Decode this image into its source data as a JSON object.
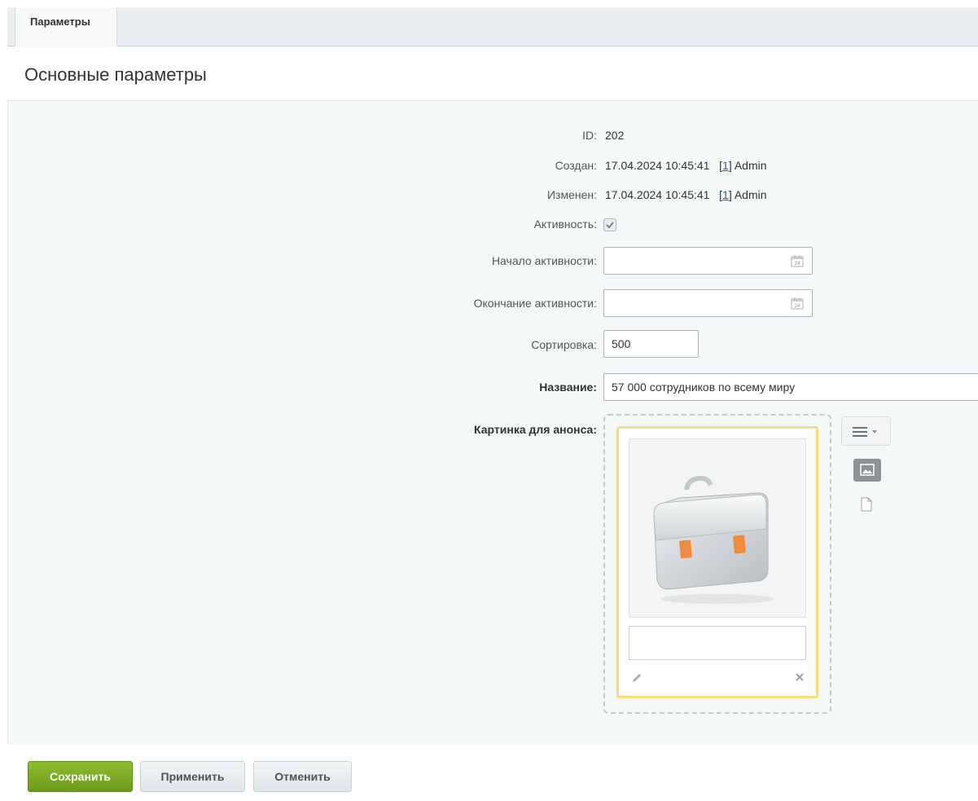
{
  "tabs": [
    {
      "label": "Параметры"
    }
  ],
  "section": {
    "title": "Основные параметры"
  },
  "fields": {
    "id": {
      "label": "ID:",
      "value": "202"
    },
    "created": {
      "label": "Создан:",
      "date": "17.04.2024 10:45:41",
      "user_id": "1",
      "user_name": "Admin"
    },
    "modified": {
      "label": "Изменен:",
      "date": "17.04.2024 10:45:41",
      "user_id": "1",
      "user_name": "Admin"
    },
    "active": {
      "label": "Активность:",
      "checked": true
    },
    "active_from": {
      "label": "Начало активности:",
      "value": ""
    },
    "active_to": {
      "label": "Окончание активности:",
      "value": ""
    },
    "sort": {
      "label": "Сортировка:",
      "value": "500"
    },
    "name": {
      "label": "Название:",
      "value": "57 000 сотрудников по всему миру"
    },
    "preview_picture": {
      "label": "Картинка для анонса:",
      "description": ""
    }
  },
  "icons": {
    "calendar": "calendar-icon",
    "menu": "menu-icon",
    "image_mode": "image-icon",
    "file_mode": "file-icon",
    "edit": "pencil-icon",
    "delete": "close-icon"
  },
  "buttons": {
    "save": "Сохранить",
    "apply": "Применить",
    "cancel": "Отменить"
  },
  "colors": {
    "primary": "#78a81f",
    "accent_card": "#f3de79",
    "link": "#2067b0"
  }
}
